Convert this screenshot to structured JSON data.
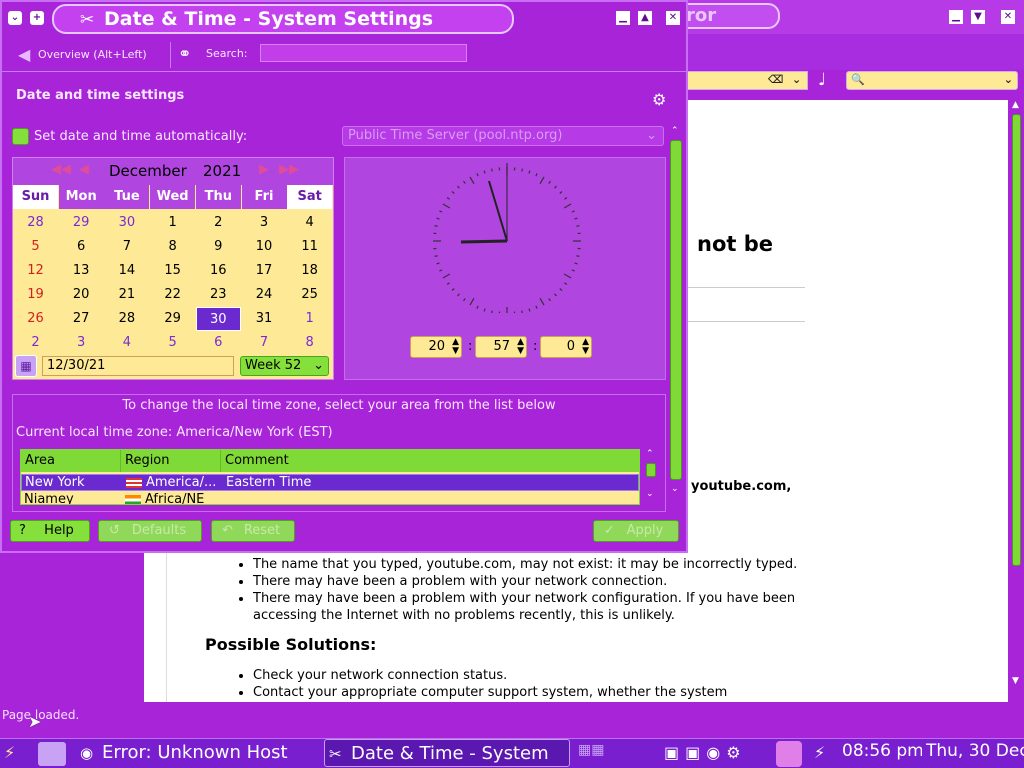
{
  "browser": {
    "title_fragment": "ror",
    "heading_fragment": "not be",
    "youtube_fragment": "youtube.com,",
    "bullets1": [
      "The name that you typed, youtube.com, may not exist: it may be incorrectly typed.",
      "There may have been a problem with your network connection.",
      "There may have been a problem with your network configuration. If you have been accessing the Internet with no problems recently, this is unlikely."
    ],
    "solutions_heading": "Possible Solutions:",
    "bullets2": [
      "Check your network connection status.",
      "Contact your appropriate computer support system, whether the system"
    ],
    "status": "Page loaded."
  },
  "dialog": {
    "title": "Date & Time - System Settings",
    "overview_label": "Overview (Alt+Left)",
    "search_label": "Search:",
    "section_title": "Date and time settings",
    "auto_label": "Set date and time automatically:",
    "time_server": "Public Time Server (pool.ntp.org)",
    "calendar": {
      "month": "December",
      "year": "2021",
      "weekdays": [
        "Sun",
        "Mon",
        "Tue",
        "Wed",
        "Thu",
        "Fri",
        "Sat"
      ],
      "weeks": [
        [
          "28",
          "29",
          "30",
          "1",
          "2",
          "3",
          "4"
        ],
        [
          "5",
          "6",
          "7",
          "8",
          "9",
          "10",
          "11"
        ],
        [
          "12",
          "13",
          "14",
          "15",
          "16",
          "17",
          "18"
        ],
        [
          "19",
          "20",
          "21",
          "22",
          "23",
          "24",
          "25"
        ],
        [
          "26",
          "27",
          "28",
          "29",
          "30",
          "31",
          "1"
        ],
        [
          "2",
          "3",
          "4",
          "5",
          "6",
          "7",
          "8"
        ]
      ],
      "selected_day": "30",
      "date_field": "12/30/21",
      "week_label": "Week 52"
    },
    "time": {
      "hour": "20",
      "minute": "57",
      "second": "0",
      "separator": ":"
    },
    "timezone": {
      "instruction": "To change the local time zone, select your area from the list below",
      "current": "Current local time zone: America/New York (EST)",
      "columns": [
        "Area",
        "Region",
        "Comment"
      ],
      "rows": [
        {
          "area": "New York",
          "region": "America/...",
          "comment": "Eastern Time"
        },
        {
          "area": "Niamey",
          "region": "Africa/NE",
          "comment": ""
        }
      ]
    },
    "buttons": {
      "help": "Help",
      "defaults": "Defaults",
      "reset": "Reset",
      "apply": "Apply"
    }
  },
  "taskbar": {
    "tasks": [
      "Error: Unknown Host",
      "Date & Time - System"
    ],
    "clock": "08:56 pm",
    "date": "Thu, 30 Dec"
  },
  "colors": {
    "accent": "#a724d8",
    "green": "#7fd936",
    "cream": "#fde996",
    "selected": "#6a2ad0"
  }
}
